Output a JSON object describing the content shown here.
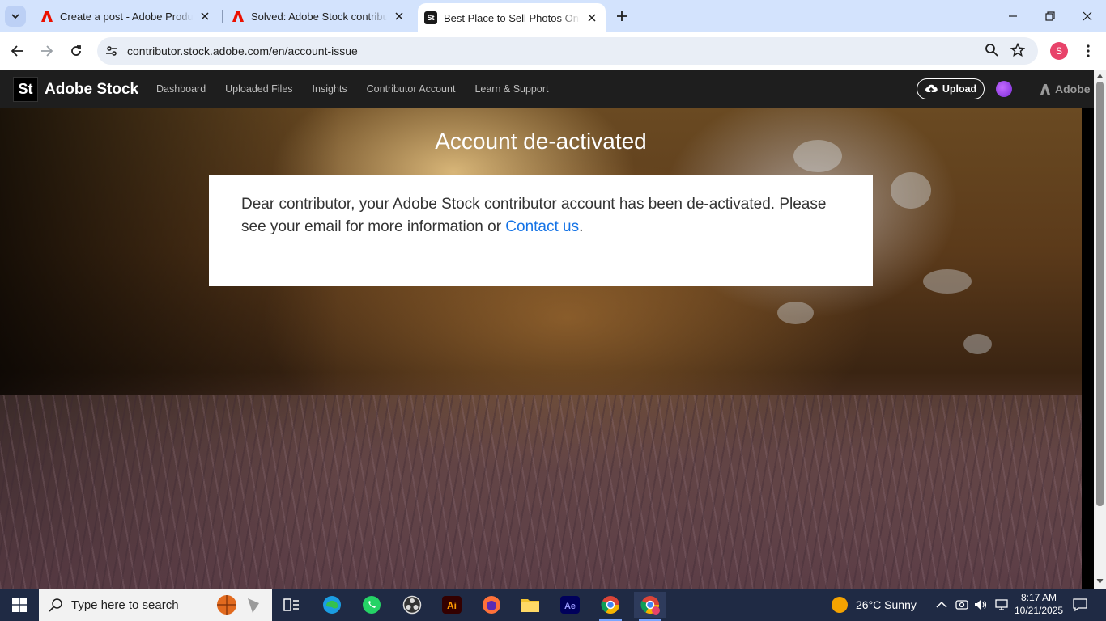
{
  "browser": {
    "tabs": [
      {
        "title": "Create a post - Adobe Product",
        "favicon": "adobe-icon",
        "active": false
      },
      {
        "title": "Solved: Adobe Stock contributo",
        "favicon": "adobe-icon",
        "active": false
      },
      {
        "title": "Best Place to Sell Photos Online",
        "favicon": "adobe-stock-icon",
        "active": true
      }
    ],
    "url": "contributor.stock.adobe.com/en/account-issue",
    "profile_initial": "S"
  },
  "stock_header": {
    "logo_text": "St",
    "brand": "Adobe Stock",
    "nav": [
      "Dashboard",
      "Uploaded Files",
      "Insights",
      "Contributor Account",
      "Learn & Support"
    ],
    "upload_label": "Upload",
    "adobe_label": "Adobe"
  },
  "page": {
    "heading": "Account de-activated",
    "message_before": "Dear contributor, your Adobe Stock contributor account has been de-activated. Please see your email for more information or ",
    "contact_link": "Contact us",
    "message_after": "."
  },
  "taskbar": {
    "search_placeholder": "Type here to search",
    "weather": "26°C  Sunny",
    "time": "8:17 AM",
    "date": "10/21/2025"
  },
  "colors": {
    "tab_strip": "#d3e3fd",
    "link": "#1473e6",
    "taskbar": "#1f2a44"
  }
}
